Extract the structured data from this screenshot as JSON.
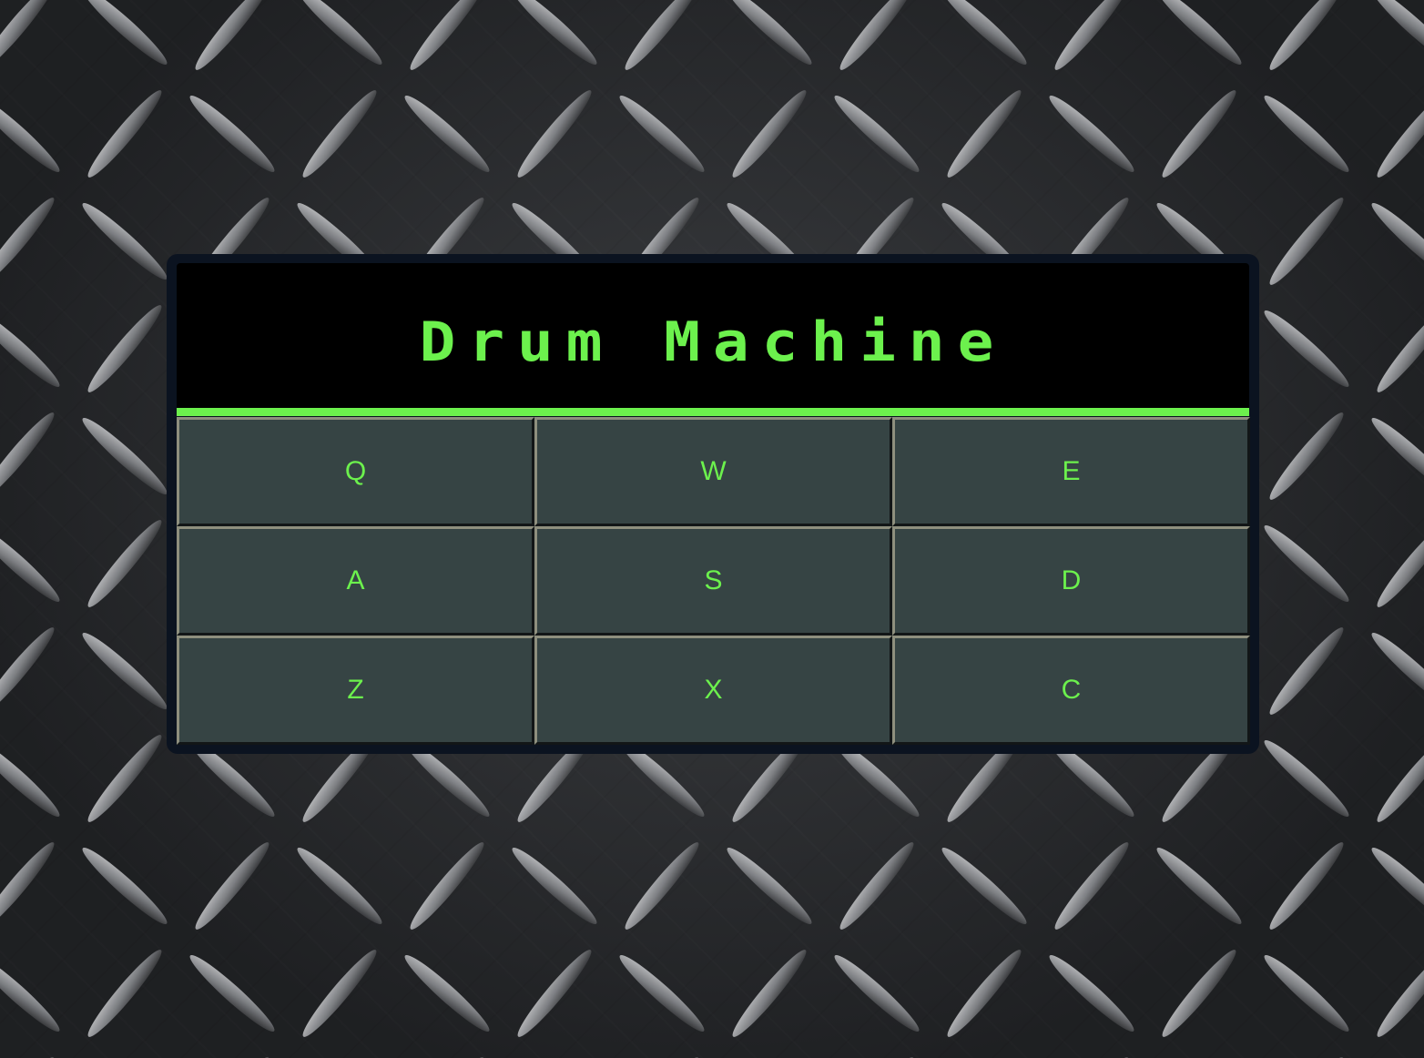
{
  "app": {
    "title": "Drum Machine"
  },
  "pads": [
    {
      "key": "Q"
    },
    {
      "key": "W"
    },
    {
      "key": "E"
    },
    {
      "key": "A"
    },
    {
      "key": "S"
    },
    {
      "key": "D"
    },
    {
      "key": "Z"
    },
    {
      "key": "X"
    },
    {
      "key": "C"
    }
  ],
  "colors": {
    "accent": "#6cf14d",
    "pad_background": "#364444",
    "display_background": "#000000",
    "frame": "#0b1320"
  },
  "icons": {
    "background": "diamond-plate-texture"
  }
}
